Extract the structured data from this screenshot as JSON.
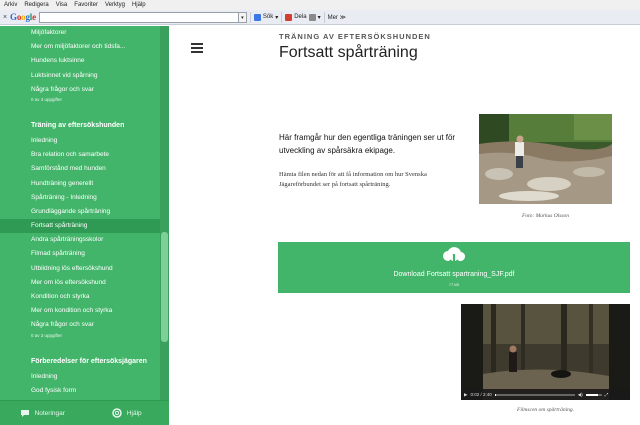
{
  "menubar": [
    "Arkiv",
    "Redigera",
    "Visa",
    "Favoriter",
    "Verktyg",
    "Hjälp"
  ],
  "toolbar": {
    "close_glyph": "×",
    "logo": {
      "g1": "G",
      "o1": "o",
      "o2": "o",
      "g2": "g",
      "l": "l",
      "e": "e"
    },
    "dropdown_glyph": "▾",
    "search_label": "Sök",
    "share_label": "Dela",
    "more_label": "Mer ≫",
    "chevron": "▾",
    "icon_colors": {
      "search": "#3b78e7",
      "share": "#d23f31",
      "extra": "#8a8a8a"
    }
  },
  "sidebar": {
    "section1_items": [
      "Miljöfaktorer",
      "Mer om miljöfaktorer och tidsfa...",
      "Hundens luktsinne",
      "Luktsinnet vid spårning",
      "Några frågor och svar"
    ],
    "section1_sub": "0 av 3 uppgifter",
    "section2_head": "Träning av eftersökshunden",
    "section2_items": [
      "Inledning",
      "Bra relation och samarbete",
      "Samförstånd med hunden",
      "Hundträning generellt",
      "Spårträning - Inledning",
      "Grundläggande spårträning",
      "Fortsatt spårträning",
      "Andra spårträningsskolor",
      "Filmad spårträning",
      "Utbildning lös eftersökshund",
      "Mer om lös eftersökshund",
      "Kondition och styrka",
      "Mer om kondition och styrka",
      "Några frågor och svar"
    ],
    "section2_active": 6,
    "section2_sub": "0 av 3 uppgifter",
    "section3_head": "Förberedelser för eftersöksjägaren",
    "section3_items": [
      "Inledning",
      "God fysisk form"
    ]
  },
  "footer": {
    "notes_label": "Noteringar",
    "help_label": "Hjälp"
  },
  "main": {
    "eyebrow": "TRÄNING AV EFTERSÖKSHUNDEN",
    "title": "Fortsatt spårträning",
    "lead": "Här framgår hur den egentliga träningen ser ut för utveckling av spårsäkra ekipage.",
    "note": "Hämta filen nedan för att få information om hur Svenska Jägareförbundet ser på fortsatt spårträning.",
    "photo_caption": "Foto: Markus Olsson",
    "download_label": "Download Fortsatt spartraning_SJF.pdf",
    "download_size": "77 kB",
    "video_time": "0:02 / 2:40",
    "video_progress": 0.01,
    "video_volume": 0.75,
    "video_caption": "Filmscen om spårträning."
  },
  "colors": {
    "sidebar": "#43b56a",
    "sidebar_active": "#2f9a54",
    "download": "#43b56a"
  }
}
